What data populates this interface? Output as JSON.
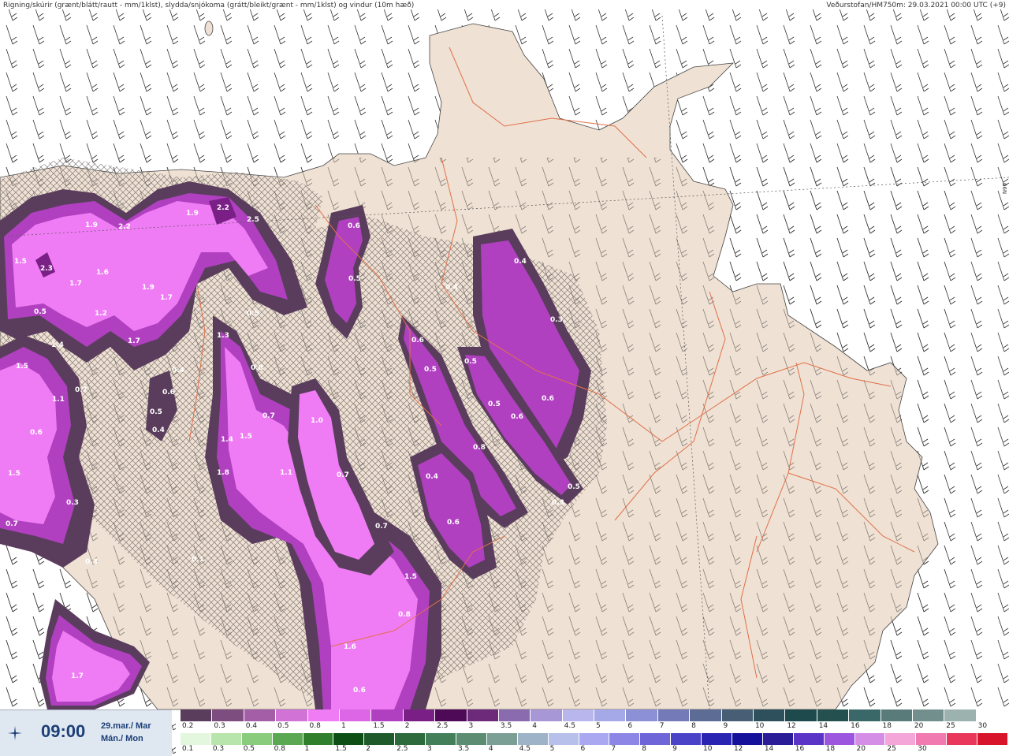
{
  "header": {
    "title": "Rigning/skúrir (grænt/blátt/rautt - mm/1klst), slydda/snjókoma (grátt/bleikt/grænt - mm/1klst) og vindur (10m hæð)",
    "source": "Veðurstofan/HM750m: 29.03.2021 00:00 UTC (+9)"
  },
  "timebox": {
    "time": "09:00",
    "date_line1": "29.mar./ Mar",
    "date_line2": "Mán./ Mon",
    "logo_icon": "vedur-logo-icon"
  },
  "map": {
    "grid_labels": [
      "66N"
    ],
    "precip_labels": [
      {
        "text": "1.9"
      },
      {
        "text": "2.2"
      },
      {
        "text": "1.9"
      },
      {
        "text": "2.2"
      },
      {
        "text": "2.5"
      },
      {
        "text": "1.5"
      },
      {
        "text": "2.3"
      },
      {
        "text": "1.7"
      },
      {
        "text": "1.6"
      },
      {
        "text": "1.9"
      },
      {
        "text": "1.7"
      },
      {
        "text": "0.5"
      },
      {
        "text": "1.2"
      },
      {
        "text": "1.7"
      },
      {
        "text": "0.5"
      },
      {
        "text": "0.6"
      },
      {
        "text": "0.5"
      },
      {
        "text": "0.4"
      },
      {
        "text": "0.4"
      },
      {
        "text": "0.3"
      },
      {
        "text": "1.5"
      },
      {
        "text": "1.4"
      },
      {
        "text": "0.7"
      },
      {
        "text": "1.1"
      },
      {
        "text": "0.6"
      },
      {
        "text": "1.5"
      },
      {
        "text": "0.7"
      },
      {
        "text": "0.3"
      },
      {
        "text": "0.3"
      },
      {
        "text": "1.3"
      },
      {
        "text": "0.8"
      },
      {
        "text": "0.4"
      },
      {
        "text": "0.6"
      },
      {
        "text": "0.5"
      },
      {
        "text": "0.4"
      },
      {
        "text": "1.4"
      },
      {
        "text": "1.5"
      },
      {
        "text": "0.7"
      },
      {
        "text": "1.8"
      },
      {
        "text": "1.1"
      },
      {
        "text": "1.0"
      },
      {
        "text": "0.7"
      },
      {
        "text": "0.7"
      },
      {
        "text": "1.5"
      },
      {
        "text": "0.8"
      },
      {
        "text": "1.6"
      },
      {
        "text": "0.6"
      },
      {
        "text": "1.7"
      },
      {
        "text": "0.6"
      },
      {
        "text": "0.5"
      },
      {
        "text": "0.5"
      },
      {
        "text": "0.5"
      },
      {
        "text": "0.6"
      },
      {
        "text": "0.8"
      },
      {
        "text": "0.4"
      },
      {
        "text": "0.6"
      },
      {
        "text": "0.5"
      },
      {
        "text": "0.6"
      },
      {
        "text": "0.3"
      },
      {
        "text": "0.1"
      }
    ]
  },
  "legend_snow": {
    "colors": [
      "#5a3d5c",
      "#7d4d80",
      "#a45ea8",
      "#d072d6",
      "#f07cf5",
      "#dd66e6",
      "#b040c0",
      "#7a1f86",
      "#4e0a57",
      "#6e2a7a",
      "#8a6bb0",
      "#a797d6",
      "#b9b6ee",
      "#a6a9e8",
      "#8c90d6",
      "#7479b8",
      "#5d6c94",
      "#475e75",
      "#2e4f5c",
      "#1e4a4d",
      "#24504f",
      "#3a6768",
      "#597c7b",
      "#738f8d",
      "#9cb2ae",
      "#ffffff"
    ],
    "labels": [
      "0.2",
      "0.3",
      "0.4",
      "0.5",
      "0.8",
      "1",
      "1.5",
      "2",
      "2.5",
      "3",
      "3.5",
      "4",
      "4.5",
      "5",
      "6",
      "7",
      "8",
      "9",
      "10",
      "12",
      "14",
      "16",
      "18",
      "20",
      "25",
      "30"
    ]
  },
  "legend_rain": {
    "colors": [
      "#e3f7de",
      "#b7e5ab",
      "#88cc7c",
      "#5aa852",
      "#2f7f2c",
      "#0d4f14",
      "#1f5a2a",
      "#2d6a3c",
      "#43805a",
      "#5c8d73",
      "#7c9f95",
      "#9eb3c7",
      "#b7c0ea",
      "#a9a8f0",
      "#8e86e6",
      "#6e66d8",
      "#4a43c8",
      "#2a24b3",
      "#16119a",
      "#2a1b96",
      "#5a34c6",
      "#9b55de",
      "#d58ee5",
      "#f4a6d8",
      "#f17bb0",
      "#e8375a",
      "#d8142a"
    ],
    "labels": [
      "0.1",
      "0.3",
      "0.5",
      "0.8",
      "1",
      "1.5",
      "2",
      "2.5",
      "3",
      "3.5",
      "4",
      "4.5",
      "5",
      "6",
      "7",
      "8",
      "9",
      "10",
      "12",
      "14",
      "16",
      "18",
      "20",
      "25",
      "30"
    ]
  }
}
